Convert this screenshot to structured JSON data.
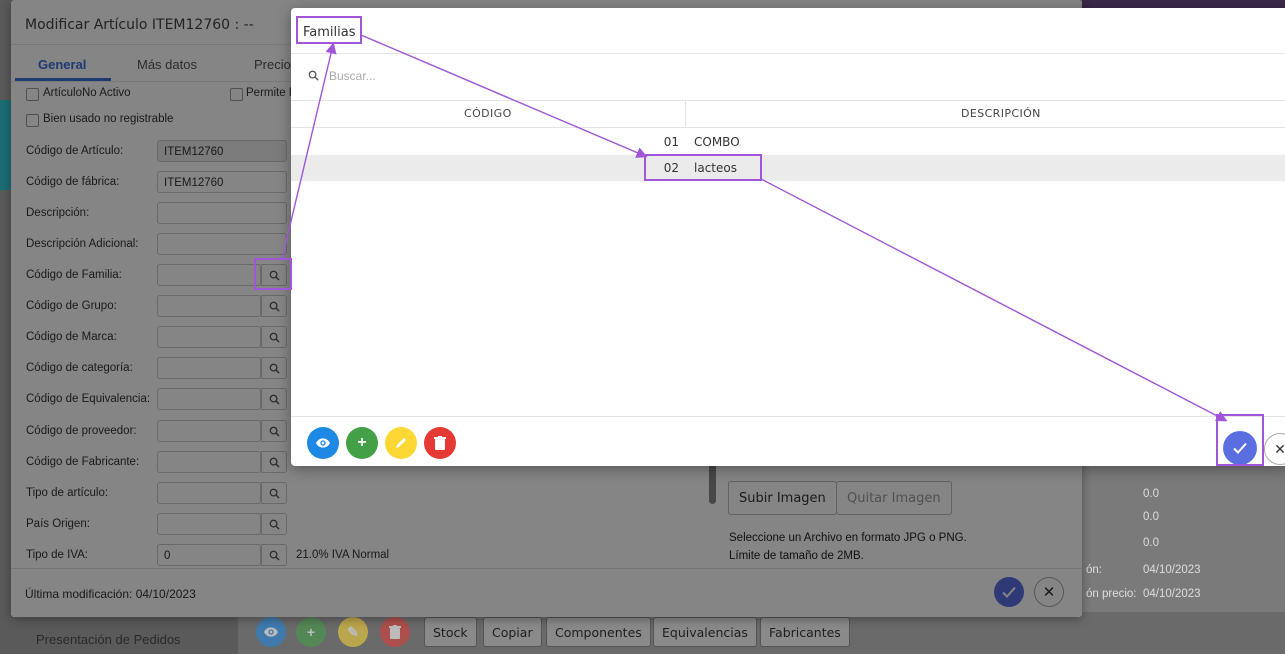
{
  "background": {
    "bottom_text": "Presentación de Pedidos",
    "toolbar_buttons": [
      "Stock",
      "Copiar",
      "Componentes",
      "Equivalencias",
      "Fabricantes"
    ],
    "right_panel": [
      {
        "label": "",
        "value": "0.0"
      },
      {
        "label": "",
        "value": "0.0"
      },
      {
        "label": "",
        "value": "0.0"
      },
      {
        "label": "ón:",
        "value": "04/10/2023"
      },
      {
        "label": "ón precio:",
        "value": "04/10/2023"
      }
    ]
  },
  "article_modal": {
    "title": "Modificar Artículo ITEM12760 : --",
    "tabs": [
      "General",
      "Más datos",
      "Precio"
    ],
    "checkboxes": [
      "ArtículoNo Activo",
      "Bien usado no registrable",
      "Permite N"
    ],
    "fields": [
      {
        "label": "Código de Artículo:",
        "value": "ITEM12760"
      },
      {
        "label": "Código de fábrica:",
        "value": "ITEM12760"
      },
      {
        "label": "Descripción:",
        "value": ""
      },
      {
        "label": "Descripción Adicional:",
        "value": ""
      },
      {
        "label": "Código de Familia:",
        "value": ""
      },
      {
        "label": "Código de Grupo:",
        "value": ""
      },
      {
        "label": "Código de Marca:",
        "value": ""
      },
      {
        "label": "Código de categoría:",
        "value": ""
      },
      {
        "label": "Código de Equivalencia:",
        "value": ""
      },
      {
        "label": "Código de proveedor:",
        "value": ""
      },
      {
        "label": "Código de Fabricante:",
        "value": ""
      },
      {
        "label": "Tipo de artículo:",
        "value": ""
      },
      {
        "label": "País Origen:",
        "value": ""
      },
      {
        "label": "Tipo de IVA:",
        "value": "0"
      }
    ],
    "iva_description": "21.0% IVA Normal",
    "upload_image_label": "Subir Imagen",
    "remove_image_label": "Quitar Imagen",
    "image_note_1": "Seleccione un Archivo en formato JPG o PNG.",
    "image_note_2": "Límite de tamaño de 2MB.",
    "last_modified": "Última modificación: 04/10/2023"
  },
  "familias_dialog": {
    "title": "Familias",
    "search_placeholder": "Buscar...",
    "columns": [
      "CÓDIGO",
      "DESCRIPCIÓN"
    ],
    "rows": [
      {
        "code": "01",
        "description": "COMBO"
      },
      {
        "code": "02",
        "description": "lacteos"
      }
    ]
  },
  "colors": {
    "view": "#1e88e5",
    "add": "#43a047",
    "edit": "#fdd835",
    "delete": "#e53935",
    "confirm": "#5b6ee1",
    "annotation": "#a056d6",
    "tab_active": "#3f6fd8"
  }
}
